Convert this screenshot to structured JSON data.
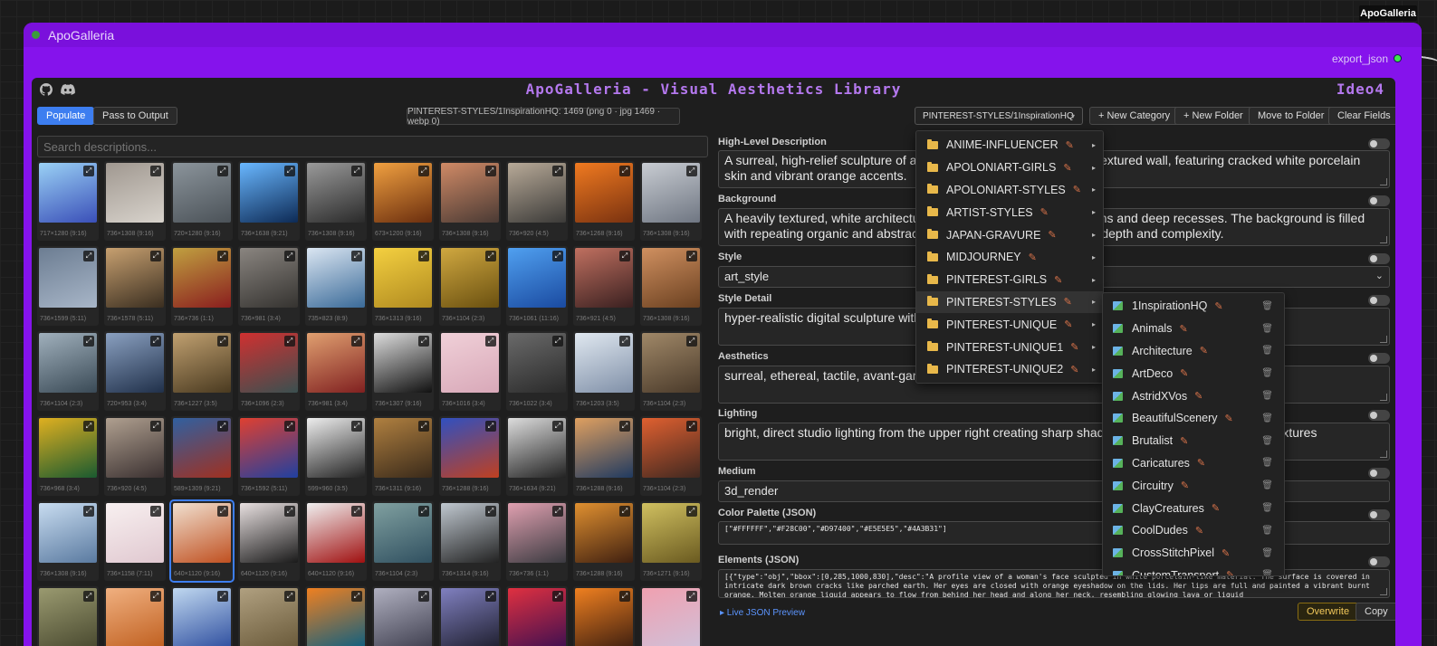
{
  "corner_badge": "ApoGalleria",
  "node": {
    "title": "ApoGalleria",
    "output_label": "export_json"
  },
  "header": {
    "title": "ApoGalleria - Visual Aesthetics Library",
    "brand": "Ideo4"
  },
  "icons": {
    "github": "github-icon",
    "discord": "discord-icon"
  },
  "toolbar": {
    "populate": "Populate",
    "pass_to_output": "Pass to Output",
    "status": "PINTEREST-STYLES/1InspirationHQ: 1469 (png 0 · jpg 1469 · webp 0)",
    "category_select": "PINTEREST-STYLES/1InspirationHQ",
    "new_category": "+ New Category",
    "new_folder": "+ New Folder",
    "move_to_folder": "Move to Folder",
    "clear_fields": "Clear Fields"
  },
  "search": {
    "placeholder": "Search descriptions..."
  },
  "gallery": {
    "dims": [
      "717×1280 (9:16)",
      "736×1308 (9:16)",
      "720×1280 (9:16)",
      "736×1638 (9:21)",
      "736×1308 (9:16)",
      "673×1200 (9:16)",
      "736×1308 (9:16)",
      "736×920 (4:5)",
      "736×1268 (9:16)",
      "736×1308 (9:16)",
      "736×1599 (5:11)",
      "736×1578 (5:11)",
      "736×736 (1:1)",
      "736×981 (3:4)",
      "735×823 (8:9)",
      "736×1313 (9:16)",
      "736×1104 (2:3)",
      "736×1061 (11:16)",
      "736×921 (4:5)",
      "736×1308 (9:16)",
      "736×1104 (2:3)",
      "720×953 (3:4)",
      "736×1227 (3:5)",
      "736×1096 (2:3)",
      "736×981 (3:4)",
      "736×1307 (9:16)",
      "736×1016 (3:4)",
      "736×1022 (3:4)",
      "736×1203 (3:5)",
      "736×1104 (2:3)",
      "736×968 (3:4)",
      "736×920 (4:5)",
      "589×1309 (9:21)",
      "736×1592 (5:11)",
      "599×960 (3:5)",
      "736×1311 (9:16)",
      "736×1288 (9:16)",
      "736×1634 (9:21)",
      "736×1288 (9:16)",
      "736×1104 (2:3)",
      "736×1308 (9:16)",
      "736×1158 (7:11)",
      "640×1120 (9:16)",
      "640×1120 (9:16)",
      "640×1120 (9:16)",
      "736×1104 (2:3)",
      "736×1314 (9:16)",
      "736×736 (1:1)",
      "736×1288 (9:16)",
      "736×1271 (9:16)",
      "",
      "",
      "",
      "",
      "",
      "",
      "",
      "",
      "",
      ""
    ],
    "selected_index": 42,
    "thumb_colors": [
      [
        "#3a4fb8",
        "#9ad1f5"
      ],
      [
        "#d8d3cc",
        "#a09890"
      ],
      [
        "#4b5258",
        "#8b949b"
      ],
      [
        "#0d2a55",
        "#69b7ff"
      ],
      [
        "#2a2a2a",
        "#9a9a9a"
      ],
      [
        "#6b2e0e",
        "#f0a040"
      ],
      [
        "#4a3a34",
        "#d08a66"
      ],
      [
        "#3b3a38",
        "#b8aa98"
      ],
      [
        "#7a3210",
        "#f07a20"
      ],
      [
        "#6f7682",
        "#c8ccd2"
      ],
      [
        "#a8b6c8",
        "#6c7d92"
      ],
      [
        "#3a2e20",
        "#c7a070"
      ],
      [
        "#8a1e1e",
        "#c0a040"
      ],
      [
        "#353330",
        "#8a8580"
      ],
      [
        "#3a6a98",
        "#dbe6f2"
      ],
      [
        "#b08a20",
        "#f4d040"
      ],
      [
        "#6a5010",
        "#d0a840"
      ],
      [
        "#1a4aa0",
        "#50a0f0"
      ],
      [
        "#3a2020",
        "#c07060"
      ],
      [
        "#6a4020",
        "#d09060"
      ],
      [
        "#3a4a56",
        "#a0b0bc"
      ],
      [
        "#20304a",
        "#8aa0c0"
      ],
      [
        "#4a3a20",
        "#c0a070"
      ],
      [
        "#3a5050",
        "#d03030"
      ],
      [
        "#802020",
        "#e0a070"
      ],
      [
        "#111",
        "#ddd"
      ],
      [
        "#d8a8b8",
        "#f0d0d8"
      ],
      [
        "#2a2a2a",
        "#6a6a6a"
      ],
      [
        "#8090a8",
        "#e0e8f0"
      ],
      [
        "#4a3a2a",
        "#a08868"
      ],
      [
        "#1a5a30",
        "#e0b020"
      ],
      [
        "#3a3030",
        "#b0a090"
      ],
      [
        "#a03020",
        "#3060a0"
      ],
      [
        "#2040a0",
        "#e04030"
      ],
      [
        "#222",
        "#eee"
      ],
      [
        "#3a2a1a",
        "#b08040"
      ],
      [
        "#c04020",
        "#3050c0"
      ],
      [
        "#222",
        "#ddd"
      ],
      [
        "#203a60",
        "#e0a060"
      ],
      [
        "#402820",
        "#e06030"
      ],
      [
        "#5a7aa0",
        "#c8dcf0"
      ],
      [
        "#e0c8d0",
        "#f8f0f0"
      ],
      [
        "#c05020",
        "#f0e0d0"
      ],
      [
        "#1a1a1a",
        "#e8e0e0"
      ],
      [
        "#a01010",
        "#f0f0f0"
      ],
      [
        "#305060",
        "#80a0a0"
      ],
      [
        "#222",
        "#c0c8d0"
      ],
      [
        "#3a3a40",
        "#e0a0b0"
      ],
      [
        "#402010",
        "#e09030"
      ],
      [
        "#6a5a20",
        "#d0c060"
      ],
      [
        "#4a4a30",
        "#9a9a70"
      ],
      [
        "#c06020",
        "#f0b080"
      ],
      [
        "#3050a0",
        "#c0d8f0"
      ],
      [
        "#6a5a3a",
        "#b0a080"
      ],
      [
        "#106080",
        "#f08020"
      ],
      [
        "#404050",
        "#b0b0c0"
      ],
      [
        "#202030",
        "#8080c0"
      ],
      [
        "#401050",
        "#e03040"
      ],
      [
        "#402010",
        "#f08020"
      ],
      [
        "#d0c0d8",
        "#f0a0b0"
      ]
    ]
  },
  "fields": {
    "high_level": {
      "label": "High-Level Description",
      "value": "A surreal, high-relief sculpture of a woman's face emerging from a textured wall, featuring cracked white porcelain skin and vibrant orange accents."
    },
    "background": {
      "label": "Background",
      "value": "A heavily textured, white architectural surface with geometric patterns and deep recesses. The background is filled with repeating organic and abstract carvings that create a sense of depth and complexity."
    },
    "style": {
      "label": "Style",
      "value": "art_style"
    },
    "style_detail": {
      "label": "Style Detail",
      "value": "hyper-realistic digital sculpture with fine crackle texture"
    },
    "aesthetics": {
      "label": "Aesthetics",
      "value": "surreal, ethereal, tactile, avant-garde"
    },
    "lighting": {
      "label": "Lighting",
      "value": "bright, direct studio lighting from the upper right creating sharp shadows that emphasize the relief textures"
    },
    "medium": {
      "label": "Medium",
      "value": "3d_render"
    },
    "palette": {
      "label": "Color Palette (JSON)",
      "value": "[\"#FFFFFF\",\"#F28C00\",\"#D97400\",\"#E5E5E5\",\"#4A3B31\"]"
    },
    "elements": {
      "label": "Elements (JSON)",
      "value": "[{\"type\":\"obj\",\"bbox\":[0,285,1000,830],\"desc\":\"A profile view of a woman's face sculpted in white porcelain-like material. The surface is covered in intricate dark brown cracks like parched earth. Her eyes are closed with orange eyeshadow on the lids. Her lips are full and painted a vibrant burnt orange. Molten orange liquid appears to flow from behind her head and along her neck, resembling glowing lava or liquid"
    }
  },
  "footer": {
    "preview_link": "▸ Live JSON Preview",
    "overwrite": "Overwrite",
    "copy": "Copy"
  },
  "category_menu": [
    {
      "label": "ANIME-INFLUENCER"
    },
    {
      "label": "APOLONIART-GIRLS"
    },
    {
      "label": "APOLONIART-STYLES"
    },
    {
      "label": "ARTIST-STYLES"
    },
    {
      "label": "JAPAN-GRAVURE"
    },
    {
      "label": "MIDJOURNEY"
    },
    {
      "label": "PINTEREST-GIRLS"
    },
    {
      "label": "PINTEREST-STYLES",
      "active": true
    },
    {
      "label": "PINTEREST-UNIQUE"
    },
    {
      "label": "PINTEREST-UNIQUE1"
    },
    {
      "label": "PINTEREST-UNIQUE2"
    }
  ],
  "subfolder_menu": [
    "1InspirationHQ",
    "Animals",
    "Architecture",
    "ArtDeco",
    "AstridXVos",
    "BeautifulScenery",
    "Brutalist",
    "Caricatures",
    "Circuitry",
    "ClayCreatures",
    "CoolDudes",
    "CrossStitchPixel",
    "CustomTransport"
  ]
}
